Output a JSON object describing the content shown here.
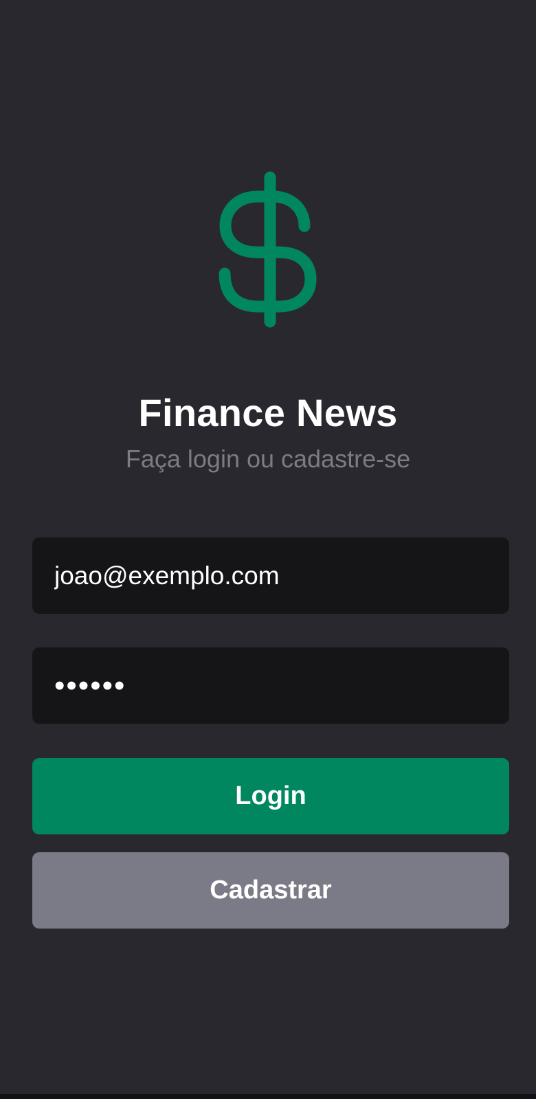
{
  "app": {
    "title": "Finance News",
    "subtitle": "Faça login ou cadastre-se",
    "logo_icon": "dollar-sign-icon",
    "accent_color": "#01875f"
  },
  "form": {
    "email_value": "joao@exemplo.com",
    "password_mask": "••••••"
  },
  "buttons": {
    "login_label": "Login",
    "register_label": "Cadastrar",
    "login_color": "#01875f",
    "register_color": "#7b7a87"
  }
}
